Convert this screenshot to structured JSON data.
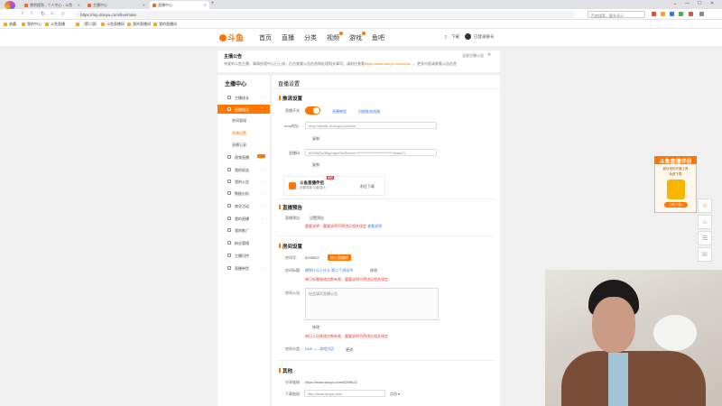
{
  "browser": {
    "brand_label": "万能家园",
    "tabs": [
      {
        "label": "想到搜到 - 个人中心 - 斗鱼",
        "active": false
      },
      {
        "label": "主播中心",
        "active": false
      },
      {
        "label": "直播中心",
        "active": true
      }
    ],
    "new_tab": "+",
    "window_controls": [
      "⌄",
      "—",
      "☐",
      "✕"
    ],
    "url": "https://mp.douyu.com/live/main",
    "search_placeholder": "百度搜索，最多显示",
    "bookmarks": [
      "收藏",
      "我的中心",
      "斗鱼直播",
      "（第二版）",
      "斗鱼直播间",
      "我的直播间",
      "我的直播间"
    ]
  },
  "site_header": {
    "logo": "斗鱼",
    "nav": [
      "首页",
      "直播",
      "分类",
      "视频",
      "游戏",
      "鱼吧"
    ],
    "download": "下载",
    "user": "已登录账号"
  },
  "notice": {
    "title": "主播公告",
    "body": "亲爱的斗鱼主播，事情处理中心已上线，后台查看公告信息和处理相关事项，请前往查看",
    "link": "https://www.douyu.com/cms/...",
    "body_tail": "，更多内容请查看公告信息",
    "read_all": "全部主播公告",
    "close": "✕"
  },
  "sidebar": {
    "title": "主播中心",
    "items": [
      {
        "label": "主播成长",
        "active": false
      },
      {
        "label": "直播相关",
        "active": true
      },
      {
        "label": "视频直播",
        "active": false
      },
      {
        "label": "我的权益",
        "active": false
      },
      {
        "label": "我的公会",
        "active": false
      },
      {
        "label": "数据分析",
        "active": false
      },
      {
        "label": "商业活动",
        "active": false
      },
      {
        "label": "我的直播",
        "active": false
      },
      {
        "label": "我的推广",
        "active": false
      },
      {
        "label": "粉丝管理",
        "active": false
      },
      {
        "label": "主播闪传",
        "active": false
      },
      {
        "label": "直播带货",
        "active": false
      }
    ],
    "sub_items": [
      "房间管理",
      "直播设置",
      "直播记录"
    ],
    "selected_sub": "直播设置"
  },
  "main": {
    "title": "直播设置",
    "push": {
      "section": "推流设置",
      "switch_label": "直播开关",
      "link1": "直播教程",
      "link2": "切换推流线路",
      "rtmp_label": "rtmp地址:",
      "rtmp_value": "rtmp://sendtc.lv.douyu.com/live",
      "copy1": "复制",
      "code_label": "直播码:",
      "code_value": "6209622rOBypVgmFecSecret=****************************&aas71",
      "copy2": "复制",
      "promo_title": "斗鱼直播伴侣",
      "promo_sub": "设置简单 功能强大",
      "promo_hot": "推荐",
      "promo_download": "前往下载"
    },
    "preview": {
      "section": "直播预告",
      "label": "直播预告:",
      "action": "设置预告",
      "warn": "重要说明：重要说明不得违反相关规定",
      "warn_link": "查看说明"
    },
    "room": {
      "section": "房间设置",
      "id_label": "房间号:",
      "id_value": "6209622",
      "id_button": "进入直播间",
      "title_label": "房间标题:",
      "title_value": "想到什么上什么 第二个测试中",
      "title_edit": "修改",
      "title_warn": "每日标题修改次数有限，重要说明不得违反相关规定",
      "notice_label": "房间公告:",
      "notice_placeholder": "在此填写直播公告...",
      "notice_edit": "修改",
      "notice_warn": "每日公告修改次数有限，重要说明不得违反相关规定",
      "category_label": "房间分类:",
      "category_value": "DNF——游戏分区",
      "category_edit": "更改"
    },
    "other": {
      "section": "其他",
      "share_label": "分享链接:",
      "share_value": "https://www.douyu.com/6209622",
      "download_label": "下载链接:",
      "download_value": "http://www.douyu.com/",
      "download_action": "点击 ▾"
    }
  },
  "float_promo": {
    "title": "斗鱼直播伴侣",
    "sub1": "超好用的开播工具",
    "sub2": "免费下载",
    "button": "立即下载 ▸"
  },
  "side_buttons": [
    "☺",
    "⌂",
    "☰",
    "☏"
  ]
}
